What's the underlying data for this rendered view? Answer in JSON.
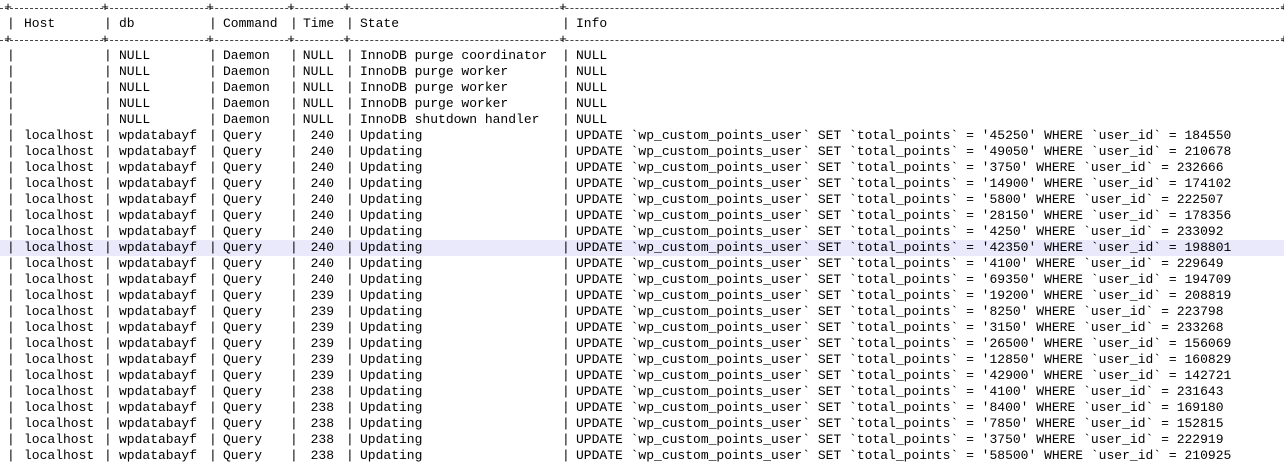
{
  "table": {
    "columns": [
      "Host",
      "db",
      "Command",
      "Time",
      "State",
      "Info"
    ],
    "highlight_color": "#e9e9fb",
    "highlight_row_index": 12,
    "rows": [
      {
        "host": "",
        "db": "NULL",
        "command": "Daemon",
        "time": "NULL",
        "state": "InnoDB purge coordinator",
        "info": "NULL"
      },
      {
        "host": "",
        "db": "NULL",
        "command": "Daemon",
        "time": "NULL",
        "state": "InnoDB purge worker",
        "info": "NULL"
      },
      {
        "host": "",
        "db": "NULL",
        "command": "Daemon",
        "time": "NULL",
        "state": "InnoDB purge worker",
        "info": "NULL"
      },
      {
        "host": "",
        "db": "NULL",
        "command": "Daemon",
        "time": "NULL",
        "state": "InnoDB purge worker",
        "info": "NULL"
      },
      {
        "host": "",
        "db": "NULL",
        "command": "Daemon",
        "time": "NULL",
        "state": "InnoDB shutdown handler",
        "info": "NULL"
      },
      {
        "host": "localhost",
        "db": "wpdatabayf",
        "command": "Query",
        "time": "240",
        "state": "Updating",
        "info": "UPDATE `wp_custom_points_user` SET `total_points` = '45250' WHERE `user_id` = 184550"
      },
      {
        "host": "localhost",
        "db": "wpdatabayf",
        "command": "Query",
        "time": "240",
        "state": "Updating",
        "info": "UPDATE `wp_custom_points_user` SET `total_points` = '49050' WHERE `user_id` = 210678"
      },
      {
        "host": "localhost",
        "db": "wpdatabayf",
        "command": "Query",
        "time": "240",
        "state": "Updating",
        "info": "UPDATE `wp_custom_points_user` SET `total_points` = '3750' WHERE `user_id` = 232666"
      },
      {
        "host": "localhost",
        "db": "wpdatabayf",
        "command": "Query",
        "time": "240",
        "state": "Updating",
        "info": "UPDATE `wp_custom_points_user` SET `total_points` = '14900' WHERE `user_id` = 174102"
      },
      {
        "host": "localhost",
        "db": "wpdatabayf",
        "command": "Query",
        "time": "240",
        "state": "Updating",
        "info": "UPDATE `wp_custom_points_user` SET `total_points` = '5800' WHERE `user_id` = 222507"
      },
      {
        "host": "localhost",
        "db": "wpdatabayf",
        "command": "Query",
        "time": "240",
        "state": "Updating",
        "info": "UPDATE `wp_custom_points_user` SET `total_points` = '28150' WHERE `user_id` = 178356"
      },
      {
        "host": "localhost",
        "db": "wpdatabayf",
        "command": "Query",
        "time": "240",
        "state": "Updating",
        "info": "UPDATE `wp_custom_points_user` SET `total_points` = '4250' WHERE `user_id` = 233092"
      },
      {
        "host": "localhost",
        "db": "wpdatabayf",
        "command": "Query",
        "time": "240",
        "state": "Updating",
        "info": "UPDATE `wp_custom_points_user` SET `total_points` = '42350' WHERE `user_id` = 198801"
      },
      {
        "host": "localhost",
        "db": "wpdatabayf",
        "command": "Query",
        "time": "240",
        "state": "Updating",
        "info": "UPDATE `wp_custom_points_user` SET `total_points` = '4100' WHERE `user_id` = 229649"
      },
      {
        "host": "localhost",
        "db": "wpdatabayf",
        "command": "Query",
        "time": "240",
        "state": "Updating",
        "info": "UPDATE `wp_custom_points_user` SET `total_points` = '69350' WHERE `user_id` = 194709"
      },
      {
        "host": "localhost",
        "db": "wpdatabayf",
        "command": "Query",
        "time": "239",
        "state": "Updating",
        "info": "UPDATE `wp_custom_points_user` SET `total_points` = '19200' WHERE `user_id` = 208819"
      },
      {
        "host": "localhost",
        "db": "wpdatabayf",
        "command": "Query",
        "time": "239",
        "state": "Updating",
        "info": "UPDATE `wp_custom_points_user` SET `total_points` = '8250' WHERE `user_id` = 223798"
      },
      {
        "host": "localhost",
        "db": "wpdatabayf",
        "command": "Query",
        "time": "239",
        "state": "Updating",
        "info": "UPDATE `wp_custom_points_user` SET `total_points` = '3150' WHERE `user_id` = 233268"
      },
      {
        "host": "localhost",
        "db": "wpdatabayf",
        "command": "Query",
        "time": "239",
        "state": "Updating",
        "info": "UPDATE `wp_custom_points_user` SET `total_points` = '26500' WHERE `user_id` = 156069"
      },
      {
        "host": "localhost",
        "db": "wpdatabayf",
        "command": "Query",
        "time": "239",
        "state": "Updating",
        "info": "UPDATE `wp_custom_points_user` SET `total_points` = '12850' WHERE `user_id` = 160829"
      },
      {
        "host": "localhost",
        "db": "wpdatabayf",
        "command": "Query",
        "time": "239",
        "state": "Updating",
        "info": "UPDATE `wp_custom_points_user` SET `total_points` = '42900' WHERE `user_id` = 142721"
      },
      {
        "host": "localhost",
        "db": "wpdatabayf",
        "command": "Query",
        "time": "238",
        "state": "Updating",
        "info": "UPDATE `wp_custom_points_user` SET `total_points` = '4100' WHERE `user_id` = 231643"
      },
      {
        "host": "localhost",
        "db": "wpdatabayf",
        "command": "Query",
        "time": "238",
        "state": "Updating",
        "info": "UPDATE `wp_custom_points_user` SET `total_points` = '8400' WHERE `user_id` = 169180"
      },
      {
        "host": "localhost",
        "db": "wpdatabayf",
        "command": "Query",
        "time": "238",
        "state": "Updating",
        "info": "UPDATE `wp_custom_points_user` SET `total_points` = '7850' WHERE `user_id` = 152815"
      },
      {
        "host": "localhost",
        "db": "wpdatabayf",
        "command": "Query",
        "time": "238",
        "state": "Updating",
        "info": "UPDATE `wp_custom_points_user` SET `total_points` = '3750' WHERE `user_id` = 222919"
      },
      {
        "host": "localhost",
        "db": "wpdatabayf",
        "command": "Query",
        "time": "238",
        "state": "Updating",
        "info": "UPDATE `wp_custom_points_user` SET `total_points` = '58500' WHERE `user_id` = 210925"
      }
    ]
  }
}
